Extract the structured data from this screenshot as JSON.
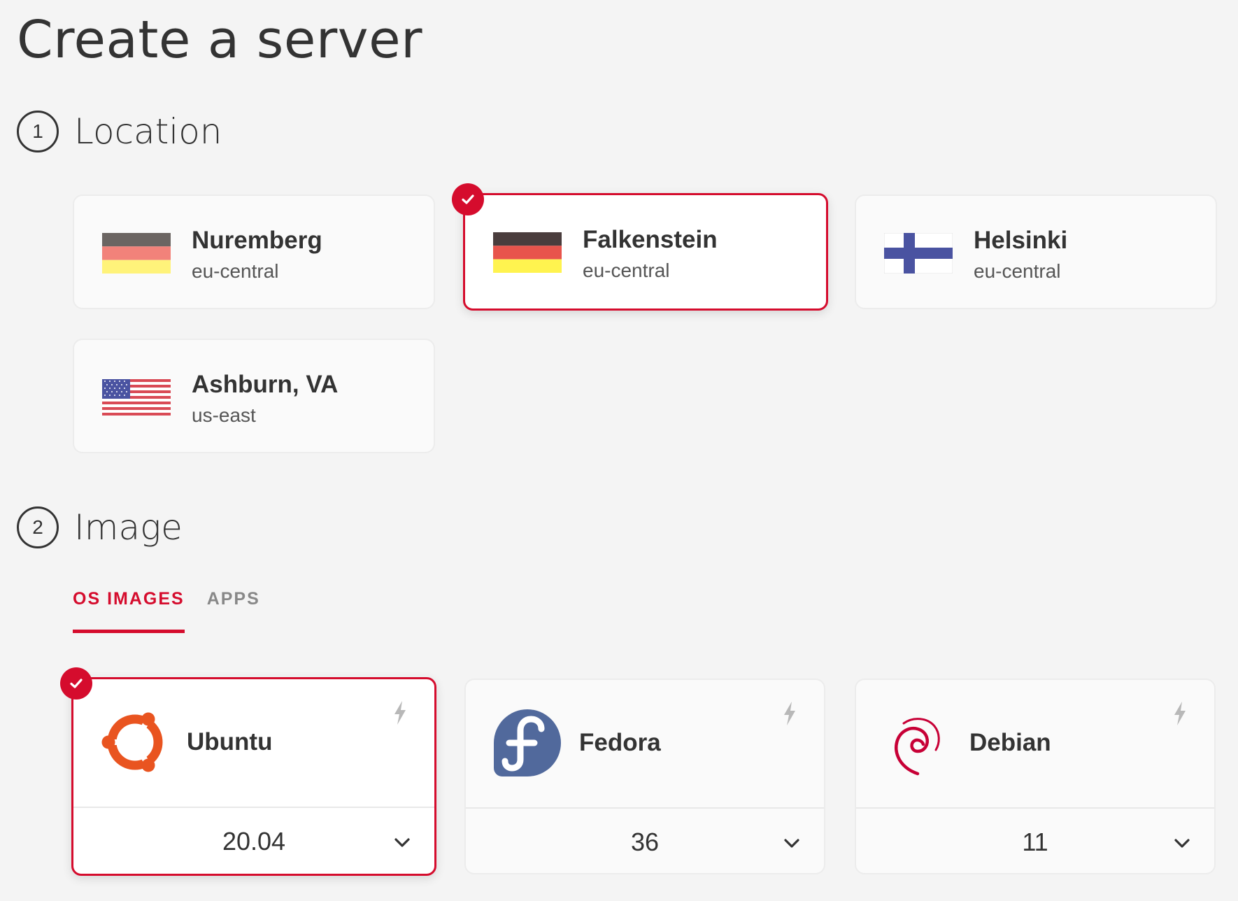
{
  "page": {
    "title": "Create a server"
  },
  "sections": {
    "location": {
      "step": "1",
      "title": "Location"
    },
    "image": {
      "step": "2",
      "title": "Image"
    }
  },
  "locations": [
    {
      "name": "Nuremberg",
      "region": "eu-central",
      "flag": "de-flag-icon",
      "selected": false
    },
    {
      "name": "Falkenstein",
      "region": "eu-central",
      "flag": "de-flag-icon",
      "selected": true
    },
    {
      "name": "Helsinki",
      "region": "eu-central",
      "flag": "fi-flag-icon",
      "selected": false
    },
    {
      "name": "Ashburn, VA",
      "region": "us-east",
      "flag": "us-flag-icon",
      "selected": false
    }
  ],
  "image_tabs": [
    {
      "label": "OS IMAGES",
      "active": true
    },
    {
      "label": "APPS",
      "active": false
    }
  ],
  "os_images": [
    {
      "name": "Ubuntu",
      "version": "20.04",
      "icon": "ubuntu-logo-icon",
      "selected": true
    },
    {
      "name": "Fedora",
      "version": "36",
      "icon": "fedora-logo-icon",
      "selected": false
    },
    {
      "name": "Debian",
      "version": "11",
      "icon": "debian-logo-icon",
      "selected": false
    }
  ],
  "colors": {
    "accent": "#d50c2d",
    "background": "#f4f4f4",
    "ubuntu_orange": "#e95420",
    "fedora_blue": "#51699c",
    "debian_red": "#c70036"
  }
}
